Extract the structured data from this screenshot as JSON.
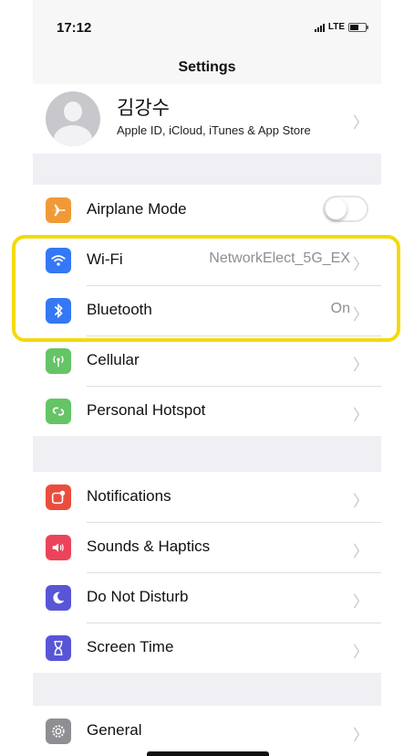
{
  "status_bar": {
    "time": "17:12",
    "network": "LTE"
  },
  "nav": {
    "title": "Settings"
  },
  "profile": {
    "name": "김강수",
    "subtitle": "Apple ID, iCloud, iTunes & App Store"
  },
  "connectivity": [
    {
      "label": "Airplane Mode",
      "icon": "airplane-icon",
      "color": "#f09a37",
      "toggle": false
    },
    {
      "label": "Wi-Fi",
      "value": "NetworkElect_5G_EX",
      "icon": "wifi-icon",
      "color": "#3478f6"
    },
    {
      "label": "Bluetooth",
      "value": "On",
      "icon": "bluetooth-icon",
      "color": "#3478f6"
    },
    {
      "label": "Cellular",
      "icon": "cellular-icon",
      "color": "#65c466"
    },
    {
      "label": "Personal Hotspot",
      "icon": "hotspot-icon",
      "color": "#65c466"
    }
  ],
  "notifications_group": [
    {
      "label": "Notifications",
      "icon": "notifications-icon",
      "color": "#eb4d3d"
    },
    {
      "label": "Sounds & Haptics",
      "icon": "speaker-icon",
      "color": "#eb445a"
    },
    {
      "label": "Do Not Disturb",
      "icon": "moon-icon",
      "color": "#5856d6"
    },
    {
      "label": "Screen Time",
      "icon": "hourglass-icon",
      "color": "#5856d6"
    }
  ],
  "general_group": [
    {
      "label": "General",
      "icon": "gear-icon",
      "color": "#8e8e93"
    }
  ],
  "highlight_color": "#f5d90a"
}
